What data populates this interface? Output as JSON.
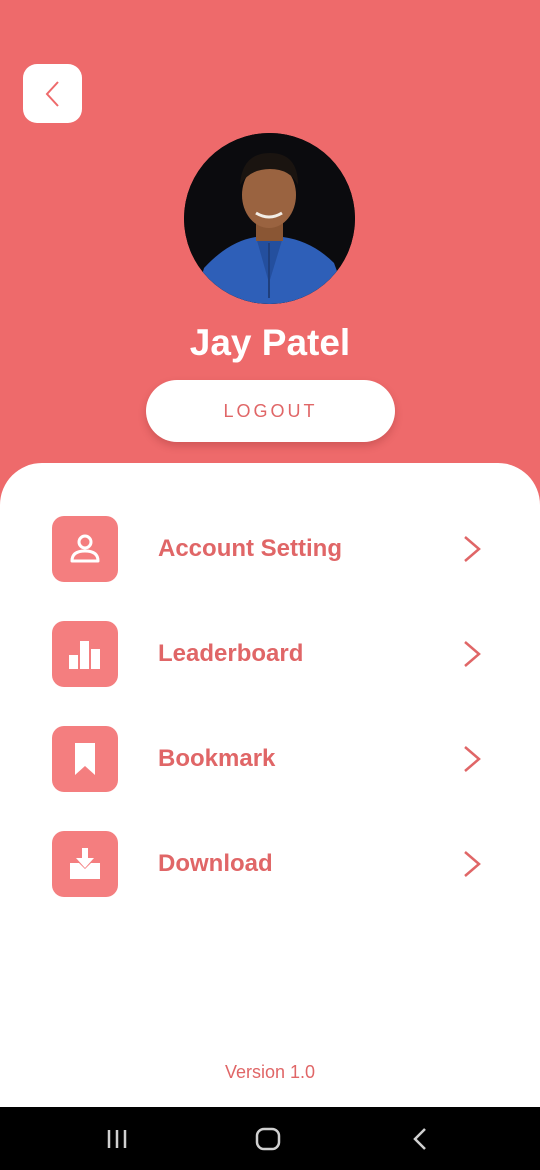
{
  "profile": {
    "name": "Jay Patel",
    "logout_label": "LOGOUT"
  },
  "menu": {
    "items": [
      {
        "label": "Account Setting",
        "icon": "user-icon"
      },
      {
        "label": "Leaderboard",
        "icon": "bar-chart-icon"
      },
      {
        "label": "Bookmark",
        "icon": "bookmark-icon"
      },
      {
        "label": "Download",
        "icon": "download-icon"
      }
    ]
  },
  "footer": {
    "version": "Version 1.0"
  },
  "theme": {
    "accent": "#ee6a6b",
    "icon_tile": "#f47e7f",
    "label_color": "#e06667"
  }
}
